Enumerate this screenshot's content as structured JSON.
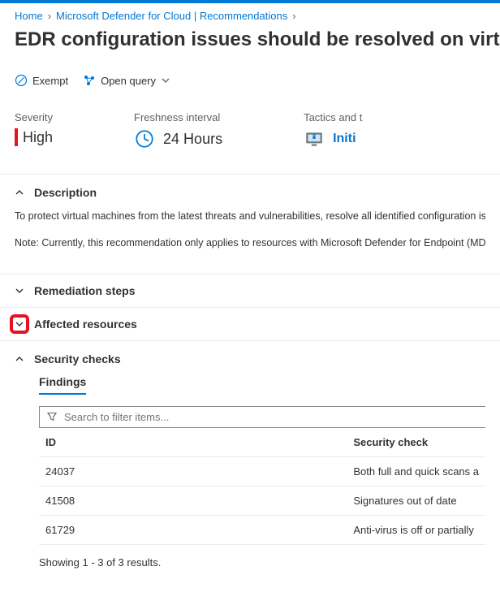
{
  "breadcrumb": {
    "home": "Home",
    "mid": "Microsoft Defender for Cloud | Recommendations"
  },
  "page_title": "EDR configuration issues should be resolved on virtual m",
  "toolbar": {
    "exempt": "Exempt",
    "open_query": "Open query"
  },
  "metrics": {
    "severity_label": "Severity",
    "severity_value": "High",
    "freshness_label": "Freshness interval",
    "freshness_value": "24 Hours",
    "tactics_label": "Tactics and t",
    "tactics_value": "Initi"
  },
  "sections": {
    "description_title": "Description",
    "description_p1": "To protect virtual machines from the latest threats and vulnerabilities, resolve all identified configuration issue",
    "description_p2": "Note: Currently, this recommendation only applies to resources with Microsoft Defender for Endpoint (MDE) e",
    "remediation_title": "Remediation steps",
    "affected_title": "Affected resources",
    "security_checks_title": "Security checks"
  },
  "findings": {
    "heading": "Findings",
    "search_placeholder": "Search to filter items...",
    "col_id": "ID",
    "col_check": "Security check",
    "rows": [
      {
        "id": "24037",
        "check": "Both full and quick scans a"
      },
      {
        "id": "41508",
        "check": "Signatures out of date"
      },
      {
        "id": "61729",
        "check": "Anti-virus is off or partially"
      }
    ],
    "results_text": "Showing 1 - 3 of 3 results."
  }
}
